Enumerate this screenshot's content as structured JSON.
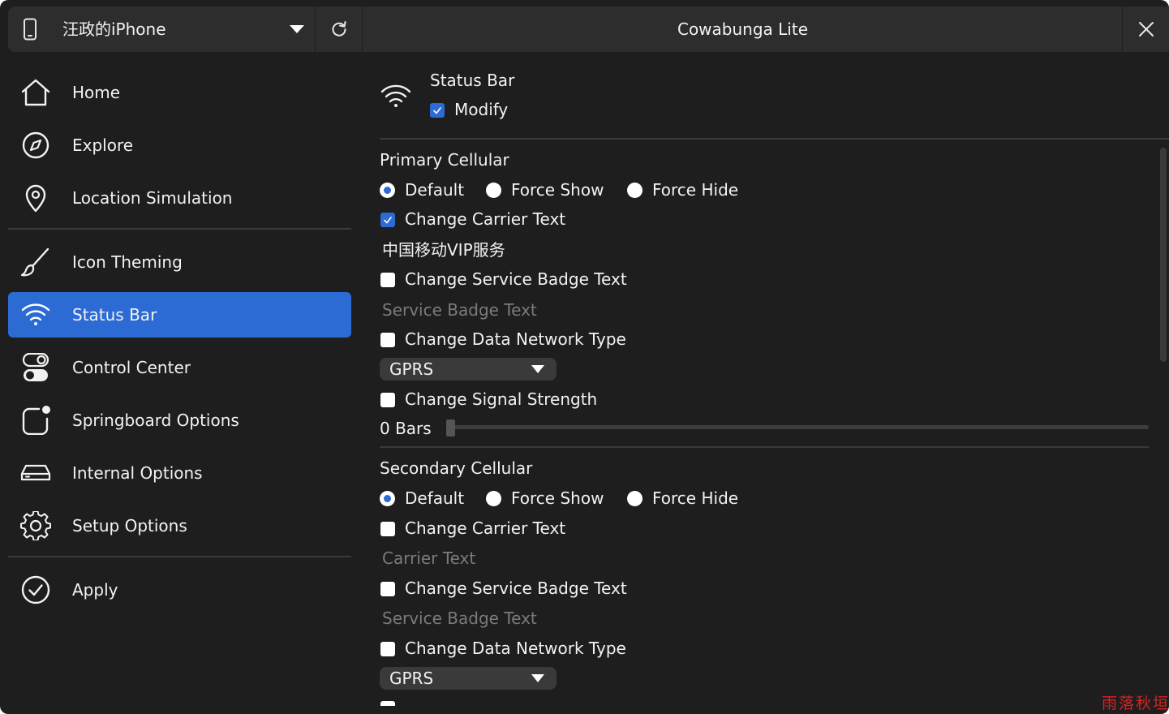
{
  "titlebar": {
    "device_name": "汪政的iPhone",
    "window_title": "Cowabunga Lite"
  },
  "sidebar": {
    "items": [
      {
        "label": "Home",
        "icon": "home-icon"
      },
      {
        "label": "Explore",
        "icon": "compass-icon"
      },
      {
        "label": "Location Simulation",
        "icon": "location-pin-icon"
      },
      {
        "label": "Icon Theming",
        "icon": "paintbrush-icon"
      },
      {
        "label": "Status Bar",
        "icon": "wifi-icon",
        "active": true
      },
      {
        "label": "Control Center",
        "icon": "toggles-icon"
      },
      {
        "label": "Springboard Options",
        "icon": "app-badge-icon"
      },
      {
        "label": "Internal Options",
        "icon": "drive-icon"
      },
      {
        "label": "Setup Options",
        "icon": "gear-icon"
      },
      {
        "label": "Apply",
        "icon": "checkmark-circle-icon"
      }
    ]
  },
  "page": {
    "title": "Status Bar",
    "modify_label": "Modify",
    "modify_checked": true
  },
  "primary": {
    "heading": "Primary Cellular",
    "radio_default": "Default",
    "radio_force_show": "Force Show",
    "radio_force_hide": "Force Hide",
    "selected": "Default",
    "change_carrier_label": "Change Carrier Text",
    "change_carrier_checked": true,
    "carrier_text_value": "中国移动VIP服务",
    "change_badge_label": "Change Service Badge Text",
    "badge_placeholder": "Service Badge Text",
    "change_network_label": "Change Data Network Type",
    "network_type": "GPRS",
    "change_signal_label": "Change Signal Strength",
    "signal_value": "0 Bars",
    "signal_level": 0
  },
  "secondary": {
    "heading": "Secondary Cellular",
    "radio_default": "Default",
    "radio_force_show": "Force Show",
    "radio_force_hide": "Force Hide",
    "selected": "Default",
    "change_carrier_label": "Change Carrier Text",
    "carrier_placeholder": "Carrier Text",
    "change_badge_label": "Change Service Badge Text",
    "badge_placeholder": "Service Badge Text",
    "change_network_label": "Change Data Network Type",
    "network_type": "GPRS"
  },
  "watermark": "雨落秋垣",
  "colors": {
    "accent": "#2c6bd4",
    "background": "#1e1e1e",
    "titlebar": "#2d2d2d",
    "muted_text": "#7b7b7b"
  }
}
